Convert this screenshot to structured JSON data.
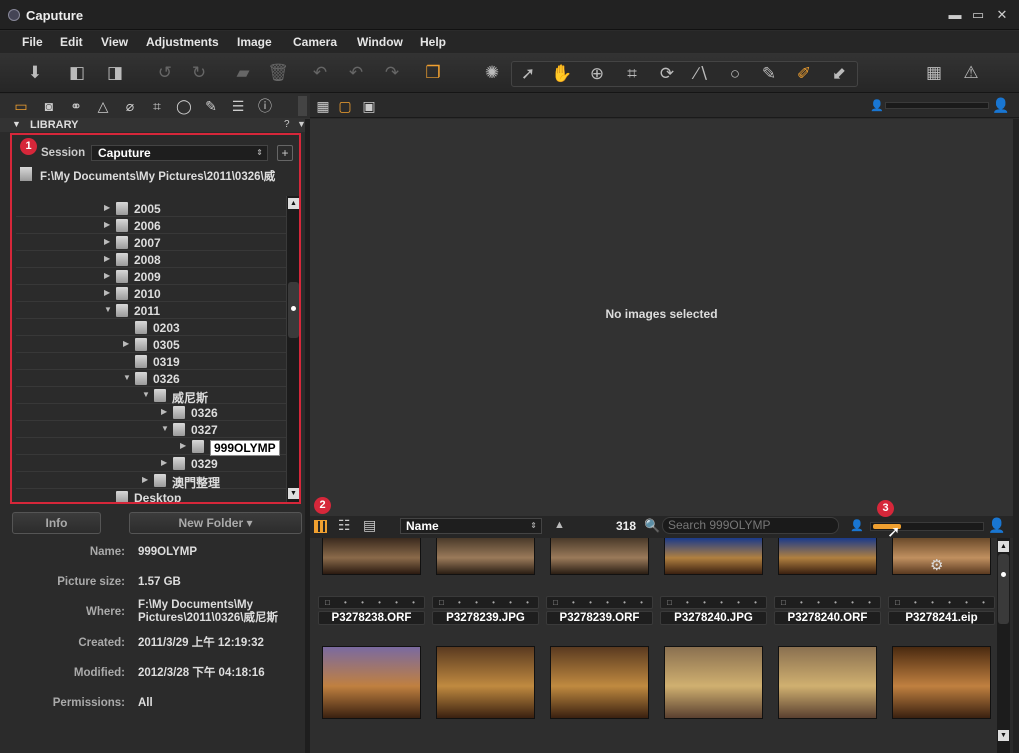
{
  "app": {
    "title": "Caputure"
  },
  "window": {
    "minimize": "▬",
    "maximize": "▭",
    "close": "✕"
  },
  "menu": [
    "File",
    "Edit",
    "View",
    "Adjustments",
    "Image",
    "Camera",
    "Window",
    "Help"
  ],
  "library": {
    "header": "LIBRARY",
    "help": "?",
    "session_label": "Session",
    "session_value": "Caputure",
    "path": "F:\\My Documents\\My Pictures\\2011\\0326\\威",
    "folders": [
      {
        "name": "2005",
        "indent": 0,
        "expander": "collapsed"
      },
      {
        "name": "2006",
        "indent": 0,
        "expander": "collapsed"
      },
      {
        "name": "2007",
        "indent": 0,
        "expander": "collapsed"
      },
      {
        "name": "2008",
        "indent": 0,
        "expander": "collapsed"
      },
      {
        "name": "2009",
        "indent": 0,
        "expander": "collapsed"
      },
      {
        "name": "2010",
        "indent": 0,
        "expander": "collapsed"
      },
      {
        "name": "2011",
        "indent": 0,
        "expander": "expanded"
      },
      {
        "name": "0203",
        "indent": 1,
        "expander": "none"
      },
      {
        "name": "0305",
        "indent": 1,
        "expander": "collapsed"
      },
      {
        "name": "0319",
        "indent": 1,
        "expander": "none"
      },
      {
        "name": "0326",
        "indent": 1,
        "expander": "expanded"
      },
      {
        "name": "威尼斯",
        "indent": 2,
        "expander": "expanded"
      },
      {
        "name": "0326",
        "indent": 3,
        "expander": "collapsed"
      },
      {
        "name": "0327",
        "indent": 3,
        "expander": "expanded"
      },
      {
        "name": "999OLYMP",
        "indent": 4,
        "expander": "collapsed",
        "selected": true
      },
      {
        "name": "0329",
        "indent": 3,
        "expander": "collapsed"
      },
      {
        "name": "澳門整理",
        "indent": 2,
        "expander": "collapsed"
      },
      {
        "name": "Desktop",
        "indent": 0,
        "expander": "none"
      }
    ]
  },
  "badges": {
    "one": "1",
    "two": "2",
    "three": "3"
  },
  "info": {
    "info_button": "Info",
    "new_folder_button": "New Folder ▾",
    "name_label": "Name:",
    "name_value": "999OLYMP",
    "size_label": "Picture size:",
    "size_value": "1.57 GB",
    "where_label": "Where:",
    "where_line1": "F:\\My Documents\\My",
    "where_line2": "Pictures\\2011\\0326\\威尼斯",
    "created_label": "Created:",
    "created_value": "2011/3/29 上午 12:19:32",
    "modified_label": "Modified:",
    "modified_value": "2012/3/28 下午 04:18:16",
    "permissions_label": "Permissions:",
    "permissions_value": "All"
  },
  "viewer": {
    "empty_message": "No images selected"
  },
  "browser": {
    "sort_value": "Name",
    "count": "318",
    "search_placeholder": "Search 999OLYMP",
    "row1": [
      {
        "filename": "P3278238.ORF",
        "colors": [
          "#3a2a1e",
          "#8a6a4a",
          "#2a1a10"
        ]
      },
      {
        "filename": "P3278239.JPG",
        "colors": [
          "#4a3a2a",
          "#9a7a5a",
          "#2a1e14"
        ]
      },
      {
        "filename": "P3278239.ORF",
        "colors": [
          "#4a3a2a",
          "#9a7a5a",
          "#2a1e14"
        ]
      },
      {
        "filename": "P3278240.JPG",
        "colors": [
          "#1a3a8a",
          "#b08040",
          "#3a2010"
        ]
      },
      {
        "filename": "P3278240.ORF",
        "colors": [
          "#1a3a8a",
          "#b08040",
          "#3a2010"
        ]
      },
      {
        "filename": "P3278241.eip",
        "colors": [
          "#6a4a2a",
          "#c09060",
          "#5a3a20"
        ]
      }
    ],
    "row2": [
      {
        "colors": [
          "#7a6aa0",
          "#c08040",
          "#3a2010"
        ]
      },
      {
        "colors": [
          "#5a3a20",
          "#c08a40",
          "#3a2010"
        ]
      },
      {
        "colors": [
          "#5a3a20",
          "#c08a40",
          "#3a2010"
        ]
      },
      {
        "colors": [
          "#8a7050",
          "#d0b070",
          "#5a4030"
        ]
      },
      {
        "colors": [
          "#8a7050",
          "#d0b070",
          "#5a4030"
        ]
      },
      {
        "colors": [
          "#4a2a10",
          "#c08040",
          "#3a2010"
        ]
      }
    ]
  }
}
